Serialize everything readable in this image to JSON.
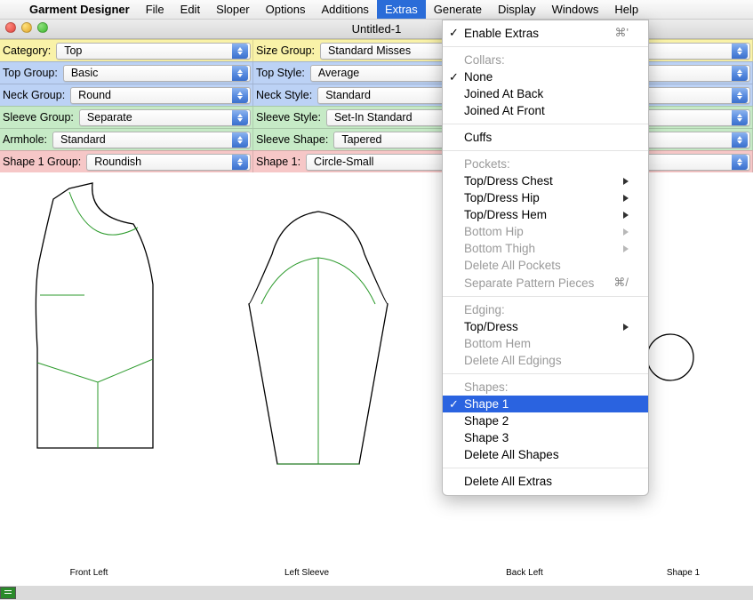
{
  "menubar": {
    "app_name": "Garment Designer",
    "items": [
      "File",
      "Edit",
      "Sloper",
      "Options",
      "Additions",
      "Extras",
      "Generate",
      "Display",
      "Windows",
      "Help"
    ],
    "active_index": 5
  },
  "window": {
    "title": "Untitled-1"
  },
  "property_rows": [
    {
      "tint": "tint-yellow",
      "cells": [
        {
          "label": "Category:",
          "value": "Top",
          "flex": 1
        },
        {
          "label": "Size Group:",
          "value": "Standard Misses",
          "flex": 2
        }
      ]
    },
    {
      "tint": "tint-blue",
      "cells": [
        {
          "label": "Top Group:",
          "value": "Basic",
          "flex": 1
        },
        {
          "label": "Top Style:",
          "value": "Average",
          "flex": 2
        }
      ]
    },
    {
      "tint": "tint-blue",
      "cells": [
        {
          "label": "Neck Group:",
          "value": "Round",
          "flex": 1
        },
        {
          "label": "Neck Style:",
          "value": "Standard",
          "flex": 2
        }
      ]
    },
    {
      "tint": "tint-green",
      "cells": [
        {
          "label": "Sleeve Group:",
          "value": "Separate",
          "flex": 1
        },
        {
          "label": "Sleeve Style:",
          "value": "Set-In Standard",
          "flex": 2
        }
      ]
    },
    {
      "tint": "tint-green",
      "cells": [
        {
          "label": "Armhole:",
          "value": "Standard",
          "flex": 1
        },
        {
          "label": "Sleeve Shape:",
          "value": "Tapered",
          "flex": 2
        }
      ]
    },
    {
      "tint": "tint-pink",
      "cells": [
        {
          "label": "Shape 1 Group:",
          "value": "Roundish",
          "flex": 1
        },
        {
          "label": "Shape 1:",
          "value": "Circle-Small",
          "flex": 2
        }
      ]
    }
  ],
  "dropdown": {
    "enable_extras": {
      "label": "Enable Extras",
      "shortcut": "⌘'"
    },
    "collars_header": "Collars:",
    "collars": [
      {
        "label": "None",
        "checked": true
      },
      {
        "label": "Joined At Back"
      },
      {
        "label": "Joined At Front"
      }
    ],
    "cuffs": "Cuffs",
    "pockets_header": "Pockets:",
    "pockets": [
      {
        "label": "Top/Dress Chest",
        "submenu": true
      },
      {
        "label": "Top/Dress Hip",
        "submenu": true
      },
      {
        "label": "Top/Dress Hem",
        "submenu": true
      },
      {
        "label": "Bottom Hip",
        "submenu": true,
        "disabled": true
      },
      {
        "label": "Bottom Thigh",
        "submenu": true,
        "disabled": true
      },
      {
        "label": "Delete All Pockets",
        "disabled": true
      },
      {
        "label": "Separate Pattern Pieces",
        "shortcut": "⌘/",
        "disabled": true
      }
    ],
    "edging_header": "Edging:",
    "edging": [
      {
        "label": "Top/Dress",
        "submenu": true
      },
      {
        "label": "Bottom Hem",
        "disabled": true
      },
      {
        "label": "Delete All Edgings",
        "disabled": true
      }
    ],
    "shapes_header": "Shapes:",
    "shapes": [
      {
        "label": "Shape 1",
        "checked": true,
        "selected": true
      },
      {
        "label": "Shape 2"
      },
      {
        "label": "Shape 3"
      },
      {
        "label": "Delete All Shapes"
      }
    ],
    "delete_all_extras": "Delete All Extras"
  },
  "pattern_labels": [
    "Front Left",
    "Left Sleeve",
    "Back Left",
    "Shape 1"
  ]
}
